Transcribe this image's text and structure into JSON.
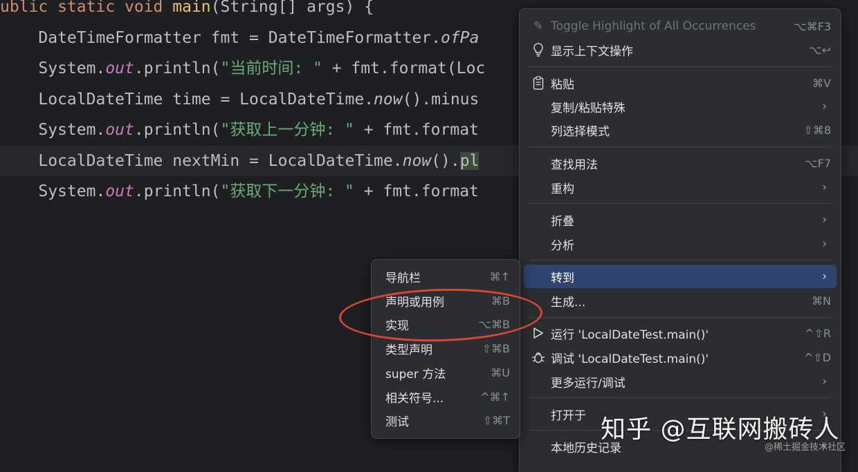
{
  "code_lines": [
    {
      "segments": [
        {
          "t": "ublic static void ",
          "c": "kw"
        },
        {
          "t": "main",
          "c": "method-yellow"
        },
        {
          "t": "(String[] args) {",
          "c": ""
        }
      ]
    },
    {
      "segments": [
        {
          "t": "    DateTimeFormatter fmt = DateTimeFormatter.",
          "c": ""
        },
        {
          "t": "ofPa",
          "c": "italic-m"
        }
      ]
    },
    {
      "segments": [
        {
          "t": "    System.",
          "c": ""
        },
        {
          "t": "out",
          "c": "italic-field"
        },
        {
          "t": ".println(",
          "c": ""
        },
        {
          "t": "\"当前时间: \"",
          "c": "str"
        },
        {
          "t": " + fmt.format(Loc",
          "c": ""
        }
      ]
    },
    {
      "segments": [
        {
          "t": "    LocalDateTime time = LocalDateTime.",
          "c": ""
        },
        {
          "t": "now",
          "c": "italic-m"
        },
        {
          "t": "().minus",
          "c": ""
        }
      ]
    },
    {
      "segments": [
        {
          "t": "    System.",
          "c": ""
        },
        {
          "t": "out",
          "c": "italic-field"
        },
        {
          "t": ".println(",
          "c": ""
        },
        {
          "t": "\"获取上一分钟: \"",
          "c": "str"
        },
        {
          "t": " + fmt.format",
          "c": ""
        }
      ]
    },
    {
      "segments": [
        {
          "t": "    LocalDateTime nextMin = LocalDateTime.",
          "c": ""
        },
        {
          "t": "now",
          "c": "italic-m"
        },
        {
          "t": "().",
          "c": ""
        },
        {
          "t": "pl",
          "c": "sel-hl"
        }
      ]
    },
    {
      "segments": [
        {
          "t": "    System.",
          "c": ""
        },
        {
          "t": "out",
          "c": "italic-field"
        },
        {
          "t": ".println(",
          "c": ""
        },
        {
          "t": "\"获取下一分钟: \"",
          "c": "str"
        },
        {
          "t": " + fmt.format",
          "c": ""
        }
      ]
    }
  ],
  "context_menu": {
    "toggle_highlight": {
      "label": "Toggle Highlight of All Occurrences",
      "shortcut": "⌥⌘F3"
    },
    "show_context_actions": {
      "label": "显示上下文操作",
      "shortcut": "⌥↩"
    },
    "paste": {
      "label": "粘贴",
      "shortcut": "⌘V"
    },
    "copy_paste_special": {
      "label": "复制/粘贴特殊"
    },
    "column_selection": {
      "label": "列选择模式",
      "shortcut": "⇧⌘8"
    },
    "find_usages": {
      "label": "查找用法",
      "shortcut": "⌥F7"
    },
    "refactor": {
      "label": "重构"
    },
    "folding": {
      "label": "折叠"
    },
    "analyze": {
      "label": "分析"
    },
    "goto": {
      "label": "转到"
    },
    "generate": {
      "label": "生成...",
      "shortcut": "⌘N"
    },
    "run": {
      "label": "运行 'LocalDateTest.main()'",
      "shortcut": "^⇧R"
    },
    "debug": {
      "label": "调试 'LocalDateTest.main()'",
      "shortcut": "^⇧D"
    },
    "more_run_debug": {
      "label": "更多运行/调试"
    },
    "open_in": {
      "label": "打开于"
    },
    "local_history": {
      "label": "本地历史记录"
    }
  },
  "goto_submenu": {
    "items": [
      {
        "label": "导航栏",
        "shortcut": "⌘↑"
      },
      {
        "label": "声明或用例",
        "shortcut": "⌘B"
      },
      {
        "label": "实现",
        "shortcut": "⌥⌘B"
      },
      {
        "label": "类型声明",
        "shortcut": "⇧⌘B"
      },
      {
        "label": "super 方法",
        "shortcut": "⌘U"
      },
      {
        "label": "相关符号...",
        "shortcut": "^⌘↑"
      },
      {
        "label": "测试",
        "shortcut": "⇧⌘T"
      }
    ]
  },
  "watermark": {
    "main": "知乎 @互联网搬砖人",
    "small": "@稀土掘金技术社区"
  },
  "colors": {
    "accent": "#2e436e",
    "annotation": "#d9482f",
    "background": "#1e1f22",
    "menu_bg": "#2b2d30"
  },
  "icons": {
    "toggle_highlight": "pencil-icon",
    "show_context_actions": "lightbulb-icon",
    "paste": "clipboard-icon",
    "run": "play-icon",
    "debug": "bug-icon",
    "submenu": "chevron-right-icon"
  }
}
